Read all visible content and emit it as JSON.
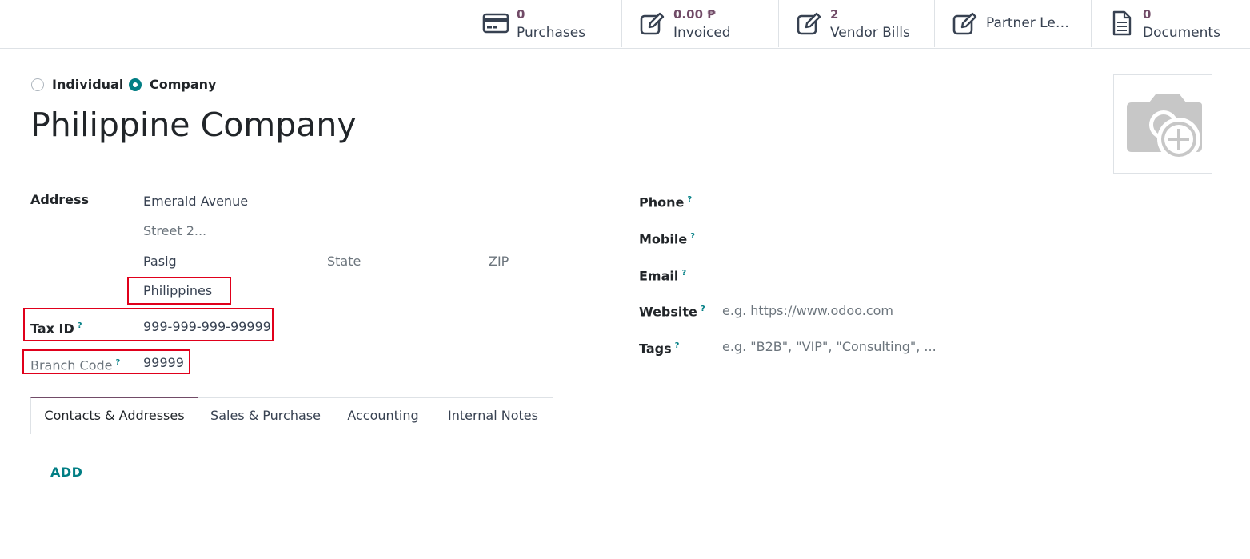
{
  "smart_buttons": [
    {
      "value": "0",
      "label": "Purchases",
      "icon": "credit-card-icon"
    },
    {
      "value": "0.00 ₱",
      "label": "Invoiced",
      "icon": "pencil-square-icon"
    },
    {
      "value": "2",
      "label": "Vendor Bills",
      "icon": "pencil-square-icon"
    },
    {
      "value": "",
      "label": "Partner Le…",
      "icon": "pencil-square-icon"
    },
    {
      "value": "0",
      "label": "Documents",
      "icon": "document-icon"
    }
  ],
  "company_type": {
    "individual_label": "Individual",
    "company_label": "Company",
    "selected": "company"
  },
  "partner": {
    "name": "Philippine Company"
  },
  "address": {
    "label": "Address",
    "street": "Emerald Avenue",
    "street2_placeholder": "Street 2...",
    "city": "Pasig",
    "state_placeholder": "State",
    "zip_placeholder": "ZIP",
    "country": "Philippines"
  },
  "tax_id": {
    "label": "Tax ID",
    "help": "?",
    "value": "999-999-999-99999"
  },
  "branch_code": {
    "label": "Branch Code",
    "help": "?",
    "value": "99999"
  },
  "contact": {
    "phone_label": "Phone",
    "mobile_label": "Mobile",
    "email_label": "Email",
    "website_label": "Website",
    "website_placeholder": "e.g. https://www.odoo.com",
    "tags_label": "Tags",
    "tags_placeholder": "e.g. \"B2B\", \"VIP\", \"Consulting\", ...",
    "help": "?"
  },
  "tabs": [
    {
      "label": "Contacts & Addresses",
      "active": true
    },
    {
      "label": "Sales & Purchase",
      "active": false
    },
    {
      "label": "Accounting",
      "active": false
    },
    {
      "label": "Internal Notes",
      "active": false
    }
  ],
  "add_label": "ADD",
  "colors": {
    "accent": "#714b67",
    "primary": "#017e84",
    "highlight_border": "#e0001b"
  }
}
